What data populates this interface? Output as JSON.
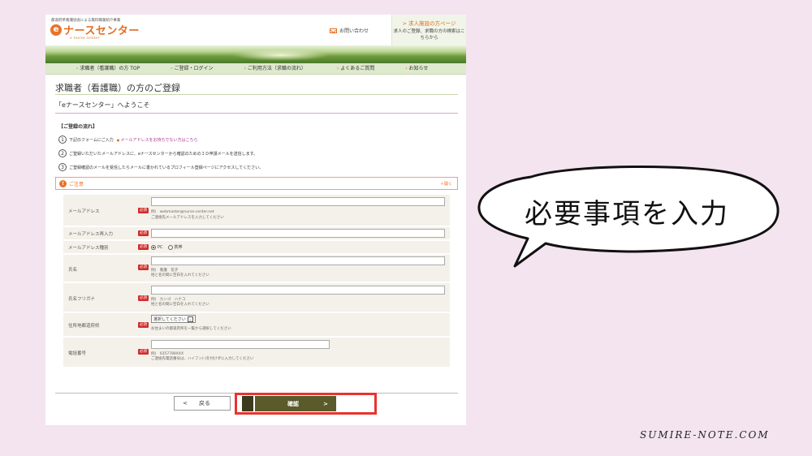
{
  "site": {
    "top_caption": "都道府県看護協会による無料職業紹介事業",
    "logo_text": "ナースセンター",
    "logo_mark": "e",
    "logo_sub": "e nurse center",
    "contact": "お問い合わせ",
    "employer_link": "> 求人施設の方ページ",
    "employer_desc": "求人のご登録、求職の方の検索はこちらから"
  },
  "nav": [
    "求職者（看護職）の方 TOP",
    "ご登録・ログイン",
    "ご利用方法（求職の流れ）",
    "よくあるご質問",
    "お知らせ"
  ],
  "page": {
    "title": "求職者（看護職）の方のご登録",
    "welcome": "「eナースセンター」へようこそ",
    "flow_heading": "【ご登録の流れ】",
    "steps": [
      {
        "num": "1",
        "text": "下記のフォームにご入力",
        "link": "メールアドレスをお持ちでない方はこちら"
      },
      {
        "num": "2",
        "text": "ご登録いただいたメールアドレスに、eナースセンターから確認のためのＩＤ申請メールを送信します。"
      },
      {
        "num": "3",
        "text": "ご登録確認のメールを受信したらメールに書かれているプロフィール登録ページにアクセスしてください。"
      }
    ],
    "notice_label": "ご注意",
    "notice_open": "＋開く",
    "required": "必須"
  },
  "form": {
    "email_label": "メールアドレス",
    "email_example": "例)　webmaster@nurse-center.net",
    "email_hint": "ご連絡先メールアドレスを入力してください",
    "email2_label": "メールアドレス再入力",
    "email_type_label": "メールアドレス種別",
    "email_type_pc": "PC",
    "email_type_mobile": "携帯",
    "name_label": "氏名",
    "name_example": "例)　看護　花子",
    "name_hint": "姓と名の間に空白を入れてください",
    "kana_label": "氏名フリガナ",
    "kana_example": "例)　カンゴ　ハナコ",
    "kana_hint": "姓と名の間に空白を入れてください",
    "pref_label": "住所地都道府県",
    "pref_value": "選択してください",
    "pref_hint": "お住まいの都道府県を一覧から選択してください",
    "tel_label": "電話番号",
    "tel_example": "例)　0357789XXX",
    "tel_hint": "ご連絡先電話番号は、ハイフン(-)を付けずに入力してください"
  },
  "buttons": {
    "back": "戻る",
    "back_arrow": "<",
    "confirm": "確認",
    "confirm_arrow": ">"
  },
  "bubble_text": "必要事項を入力",
  "footer_site": "SUMIRE-NOTE.COM",
  "colors": {
    "accent": "#e36c1e",
    "highlight": "#e8332f",
    "background": "#f3e4ef"
  }
}
